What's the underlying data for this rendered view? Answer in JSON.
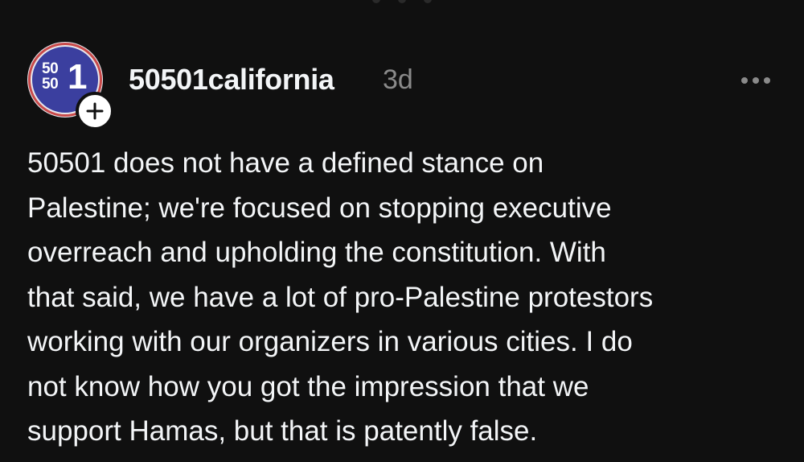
{
  "post": {
    "username": "50501california",
    "timestamp": "3d",
    "body": "50501 does not have a defined stance on\nPalestine; we're focused on stopping executive\noverreach and upholding the constitution. With\nthat said, we have a lot of pro-Palestine protestors\nworking with our organizers in various cities. I do\nnot know how you got the impression that we\nsupport Hamas, but that is patently false.",
    "avatar": {
      "logo_small": "50\n50",
      "logo_big": "1"
    },
    "icons": {
      "follow": "plus-icon",
      "more": "more-horizontal-icon"
    }
  },
  "colors": {
    "background": "#101010",
    "text": "#f3f5f7",
    "muted": "#8a8a8a",
    "avatar_blue": "#3b3f9f",
    "avatar_red": "#c94a4a"
  }
}
